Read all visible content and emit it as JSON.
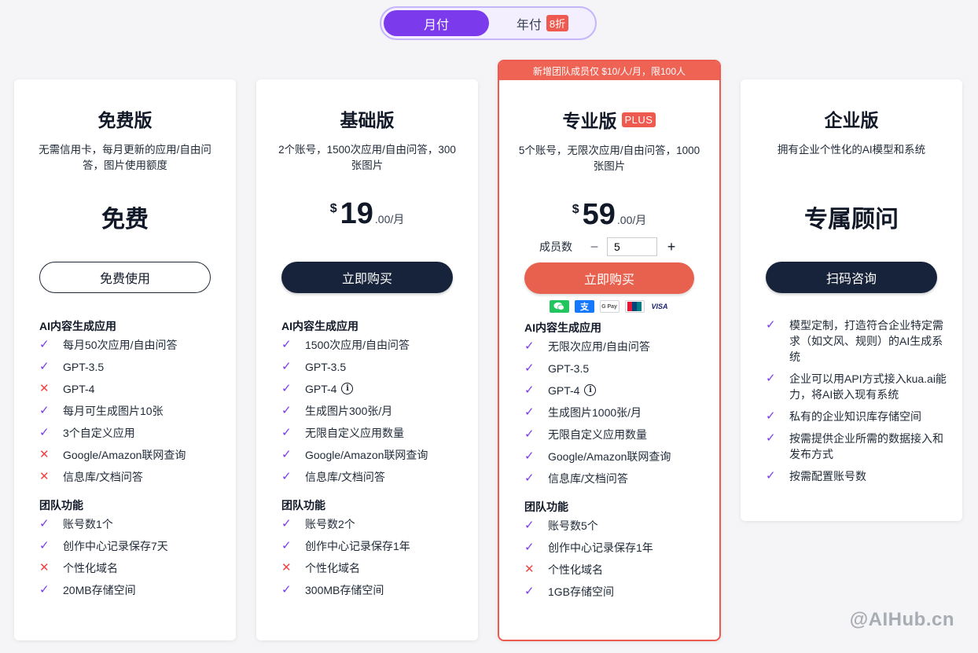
{
  "toggle": {
    "monthly": "月付",
    "yearly": "年付",
    "discount": "8折"
  },
  "colors": {
    "accent": "#7c3aed",
    "danger": "#ef5a50",
    "dark_button": "#17233a"
  },
  "plans": {
    "free": {
      "title": "免费版",
      "desc": "无需信用卡，每月更新的应用/自由问答，图片使用额度",
      "price_text": "免费",
      "button": "免费使用",
      "sections": [
        {
          "title": "AI内容生成应用",
          "items": [
            {
              "text": "每月50次应用/自由问答",
              "ok": true
            },
            {
              "text": "GPT-3.5",
              "ok": true
            },
            {
              "text": "GPT-4",
              "ok": false
            },
            {
              "text": "每月可生成图片10张",
              "ok": true
            },
            {
              "text": "3个自定义应用",
              "ok": true
            },
            {
              "text": "Google/Amazon联网查询",
              "ok": false
            },
            {
              "text": "信息库/文档问答",
              "ok": false
            }
          ]
        },
        {
          "title": "团队功能",
          "items": [
            {
              "text": "账号数1个",
              "ok": true
            },
            {
              "text": "创作中心记录保存7天",
              "ok": true
            },
            {
              "text": "个性化域名",
              "ok": false
            },
            {
              "text": "20MB存储空间",
              "ok": true
            }
          ]
        }
      ]
    },
    "basic": {
      "title": "基础版",
      "desc": "2个账号，1500次应用/自由问答，300张图片",
      "currency": "$",
      "amount": "19",
      "suffix": ".00/月",
      "button": "立即购买",
      "sections": [
        {
          "title": "AI内容生成应用",
          "items": [
            {
              "text": "1500次应用/自由问答",
              "ok": true
            },
            {
              "text": "GPT-3.5",
              "ok": true
            },
            {
              "text": "GPT-4",
              "ok": true,
              "info": true
            },
            {
              "text": "生成图片300张/月",
              "ok": true
            },
            {
              "text": "无限自定义应用数量",
              "ok": true
            },
            {
              "text": "Google/Amazon联网查询",
              "ok": true
            },
            {
              "text": "信息库/文档问答",
              "ok": true
            }
          ]
        },
        {
          "title": "团队功能",
          "items": [
            {
              "text": "账号数2个",
              "ok": true
            },
            {
              "text": "创作中心记录保存1年",
              "ok": true
            },
            {
              "text": "个性化域名",
              "ok": false
            },
            {
              "text": "300MB存储空间",
              "ok": true
            }
          ]
        }
      ]
    },
    "pro": {
      "ribbon": "新增团队成员仅 $10/人/月，限100人",
      "title": "专业版",
      "badge": "PLUS",
      "desc": "5个账号，无限次应用/自由问答，1000张图片",
      "currency": "$",
      "amount": "59",
      "suffix": ".00/月",
      "members_label": "成员数",
      "members_value": "5",
      "button": "立即购买",
      "payments": [
        "wechat-pay",
        "alipay",
        "google-pay",
        "unionpay",
        "visa"
      ],
      "gpay_label": "G Pay",
      "visa_label": "VISA",
      "sections": [
        {
          "title": "AI内容生成应用",
          "items": [
            {
              "text": "无限次应用/自由问答",
              "ok": true
            },
            {
              "text": "GPT-3.5",
              "ok": true
            },
            {
              "text": "GPT-4",
              "ok": true,
              "info": true
            },
            {
              "text": "生成图片1000张/月",
              "ok": true
            },
            {
              "text": "无限自定义应用数量",
              "ok": true
            },
            {
              "text": "Google/Amazon联网查询",
              "ok": true
            },
            {
              "text": "信息库/文档问答",
              "ok": true
            }
          ]
        },
        {
          "title": "团队功能",
          "items": [
            {
              "text": "账号数5个",
              "ok": true
            },
            {
              "text": "创作中心记录保存1年",
              "ok": true
            },
            {
              "text": "个性化域名",
              "ok": false
            },
            {
              "text": "1GB存储空间",
              "ok": true
            }
          ]
        }
      ]
    },
    "ent": {
      "title": "企业版",
      "desc": "拥有企业个性化的AI模型和系统",
      "price_text": "专属顾问",
      "button": "扫码咨询",
      "items": [
        {
          "text": "模型定制，打造符合企业特定需求（如文风、规则）的AI生成系统",
          "ok": true
        },
        {
          "text": "企业可以用API方式接入kua.ai能力，将AI嵌入现有系统",
          "ok": true
        },
        {
          "text": "私有的企业知识库存储空间",
          "ok": true
        },
        {
          "text": "按需提供企业所需的数据接入和发布方式",
          "ok": true
        },
        {
          "text": "按需配置账号数",
          "ok": true
        }
      ]
    }
  },
  "watermark": "@AIHub.cn"
}
